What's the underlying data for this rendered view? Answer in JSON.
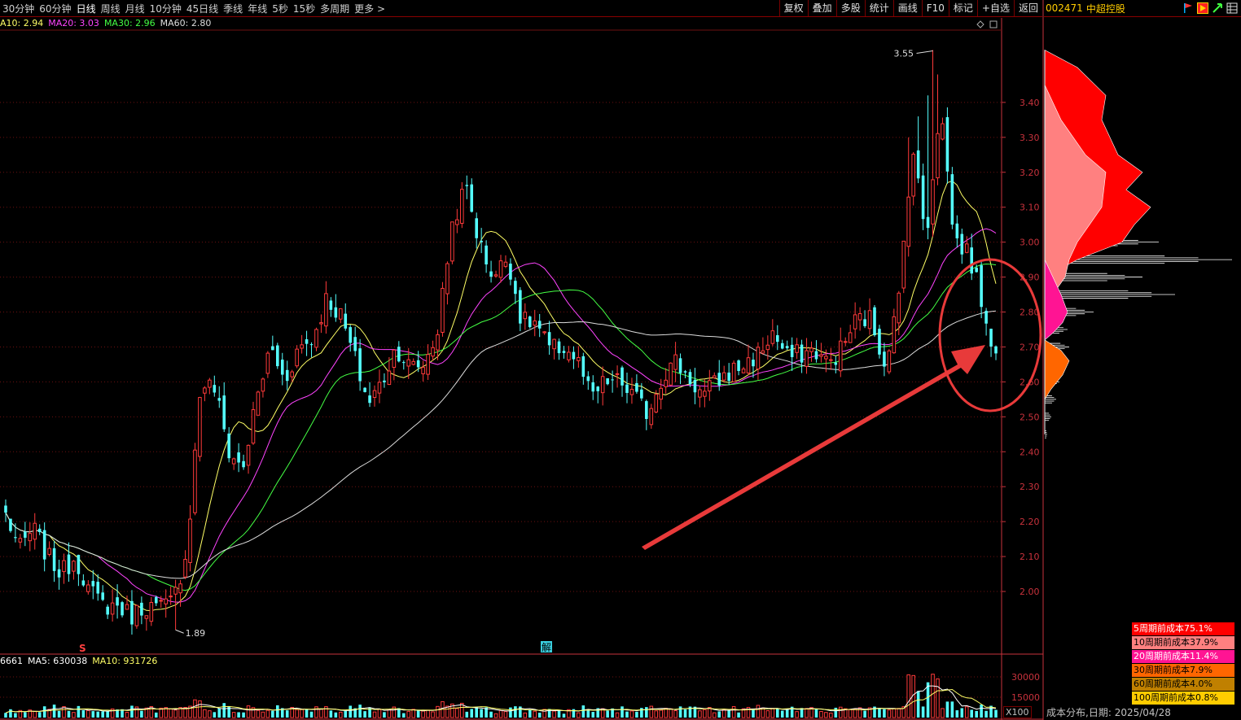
{
  "toolbar": {
    "periods": [
      "30分钟",
      "60分钟",
      "日线",
      "周线",
      "月线",
      "10分钟",
      "45日线",
      "季线",
      "年线",
      "5秒",
      "15秒",
      "多周期",
      "更多 >"
    ],
    "active_period": "日线",
    "actions": [
      "复权",
      "叠加",
      "多股",
      "统计",
      "画线",
      "F10",
      "标记",
      "+自选",
      "返回"
    ]
  },
  "stock": {
    "code": "002471",
    "name": "中超控股"
  },
  "ma_legend": [
    {
      "label": "A10: 2.94",
      "color": "#ffff66"
    },
    {
      "label": "MA20: 3.03",
      "color": "#ff44ff"
    },
    {
      "label": "MA30: 2.96",
      "color": "#44ff44"
    },
    {
      "label": "MA60: 2.80",
      "color": "#dddddd"
    }
  ],
  "vol_legend": [
    {
      "label": "6661",
      "color": "#ffffff"
    },
    {
      "label": "MA5: 630038",
      "color": "#ffffff"
    },
    {
      "label": "MA10: 931726",
      "color": "#ffff66"
    }
  ],
  "markers": {
    "s_label": "S",
    "jie_label": "解",
    "x100_label": "X100"
  },
  "cost_distribution": {
    "rows": [
      {
        "label": "5周期前成本75.1%",
        "bg": "#ff0000",
        "fg": "#ffffff"
      },
      {
        "label": "10周期前成本37.9%",
        "bg": "#ff8080",
        "fg": "#000000"
      },
      {
        "label": "20周期前成本11.4%",
        "bg": "#ff1493",
        "fg": "#ffffff"
      },
      {
        "label": "30周期前成本7.9%",
        "bg": "#ff6600",
        "fg": "#000000"
      },
      {
        "label": "60周期前成本4.0%",
        "bg": "#c08000",
        "fg": "#000000"
      },
      {
        "label": "100周期前成本0.8%",
        "bg": "#ffcc00",
        "fg": "#000000"
      }
    ],
    "footer_label": "成本分布,日期:",
    "footer_date": "2025/04/28"
  },
  "colors": {
    "up": "#ff3a3a",
    "down": "#54ffff",
    "axis": "#c8323c",
    "grid": "#6e1010"
  },
  "chart_data": {
    "type": "candlestick",
    "ylim": [
      1.83,
      3.6
    ],
    "yticks": [
      2.0,
      2.1,
      2.2,
      2.3,
      2.4,
      2.5,
      2.6,
      2.7,
      2.8,
      2.9,
      3.0,
      3.1,
      3.2,
      3.3,
      3.4
    ],
    "volume_ticks": [
      15000,
      30000
    ],
    "volume_ylim": [
      0,
      36000
    ],
    "annotations": {
      "high": 3.55,
      "low": 1.89
    },
    "anchors": [
      2.22,
      2.12,
      2.18,
      2.1,
      2.05,
      2.1,
      2.0,
      1.96,
      1.96,
      1.93,
      1.96,
      1.95,
      1.97,
      2.12,
      2.6,
      2.58,
      2.4,
      2.35,
      2.55,
      2.7,
      2.6,
      2.7,
      2.72,
      2.84,
      2.79,
      2.67,
      2.54,
      2.6,
      2.7,
      2.64,
      2.65,
      2.75,
      3.05,
      3.16,
      2.99,
      2.9,
      2.96,
      2.77,
      2.77,
      2.69,
      2.7,
      2.66,
      2.55,
      2.6,
      2.6,
      2.56,
      2.51,
      2.61,
      2.66,
      2.61,
      2.56,
      2.6,
      2.63,
      2.65,
      2.68,
      2.74,
      2.67,
      2.68,
      2.69,
      2.65,
      2.7,
      2.78,
      2.78,
      2.66,
      2.82,
      3.28,
      3.01,
      3.4,
      3.01,
      2.97,
      2.83,
      2.67
    ],
    "volume_profile": [
      [
        2.45,
        3
      ],
      [
        2.5,
        8
      ],
      [
        2.55,
        14
      ],
      [
        2.6,
        18
      ],
      [
        2.65,
        22
      ],
      [
        2.7,
        30
      ],
      [
        2.75,
        28
      ],
      [
        2.8,
        60
      ],
      [
        2.85,
        160
      ],
      [
        2.9,
        120
      ],
      [
        2.95,
        230
      ],
      [
        3.0,
        140
      ],
      [
        3.05,
        40
      ],
      [
        3.1,
        5
      ]
    ],
    "cost_layers": [
      {
        "name": "5周期前",
        "color": "#ff0000",
        "points": [
          [
            3.55,
            0
          ],
          [
            3.5,
            40
          ],
          [
            3.42,
            75
          ],
          [
            3.35,
            70
          ],
          [
            3.3,
            80
          ],
          [
            3.25,
            90
          ],
          [
            3.2,
            120
          ],
          [
            3.15,
            100
          ],
          [
            3.1,
            130
          ],
          [
            3.05,
            110
          ],
          [
            3.0,
            95
          ],
          [
            2.95,
            40
          ],
          [
            2.9,
            0
          ]
        ]
      },
      {
        "name": "10周期前",
        "color": "#ff8080",
        "points": [
          [
            3.45,
            0
          ],
          [
            3.35,
            20
          ],
          [
            3.25,
            50
          ],
          [
            3.2,
            75
          ],
          [
            3.1,
            70
          ],
          [
            3.05,
            55
          ],
          [
            3.0,
            40
          ],
          [
            2.95,
            30
          ],
          [
            2.9,
            25
          ],
          [
            2.85,
            10
          ],
          [
            2.8,
            0
          ]
        ]
      },
      {
        "name": "20周期前",
        "color": "#ff1493",
        "points": [
          [
            2.95,
            0
          ],
          [
            2.9,
            10
          ],
          [
            2.85,
            20
          ],
          [
            2.8,
            28
          ],
          [
            2.77,
            22
          ],
          [
            2.74,
            10
          ],
          [
            2.72,
            0
          ]
        ]
      },
      {
        "name": "30周期前",
        "color": "#ff6600",
        "points": [
          [
            2.72,
            0
          ],
          [
            2.69,
            20
          ],
          [
            2.66,
            30
          ],
          [
            2.62,
            22
          ],
          [
            2.58,
            8
          ],
          [
            2.55,
            0
          ]
        ]
      }
    ]
  }
}
